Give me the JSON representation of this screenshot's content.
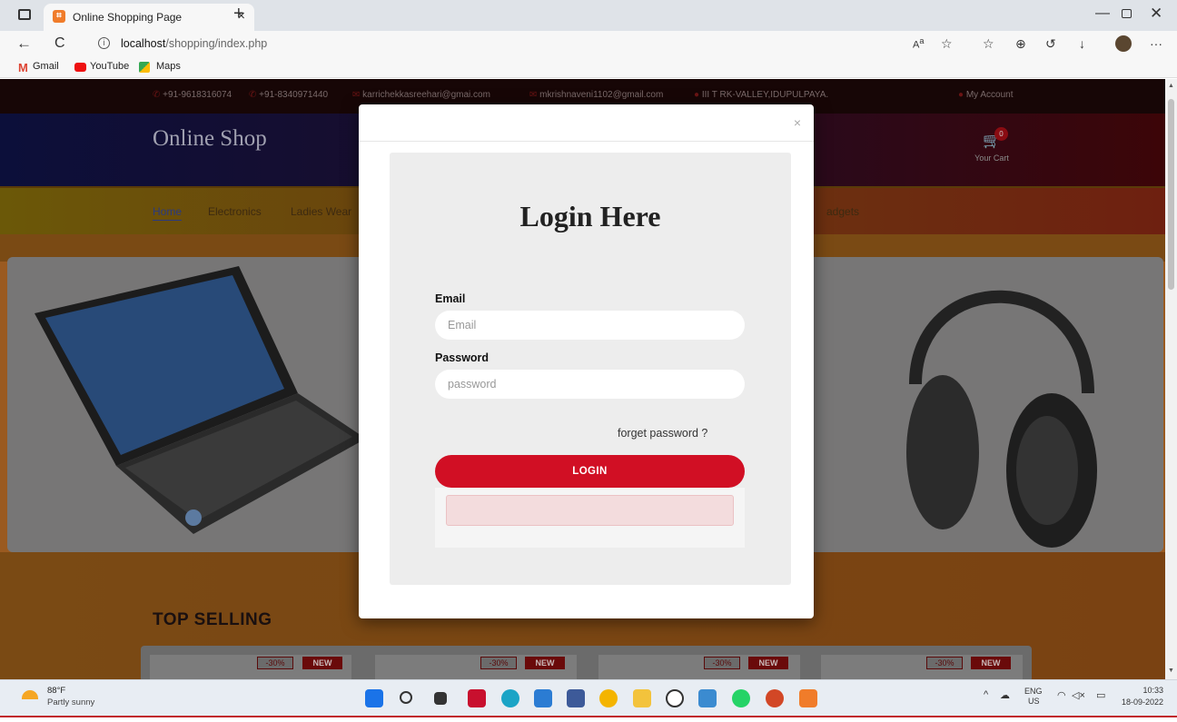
{
  "browser": {
    "tab_title": "Online Shopping Page",
    "tab_close": "×",
    "new_tab": "+",
    "url_host": "localhost",
    "url_path": "/shopping/index.php",
    "window_min": "—",
    "window_close": "✕",
    "bookmarks": [
      {
        "label": "Gmail"
      },
      {
        "label": "YouTube"
      },
      {
        "label": "Maps"
      }
    ],
    "nav_back": "←",
    "nav_refresh": "C",
    "info_icon": "i",
    "toolbar_more": "···"
  },
  "site": {
    "contact": {
      "phone1": "+91-9618316074",
      "phone2": "+91-8340971440",
      "email1": "karrichekkasreehari@gmai.com",
      "email2": "mkrishnaveni1102@gmail.com",
      "address": "III T RK-VALLEY,IDUPULPAYA."
    },
    "account_label": "My Account",
    "logo": "Online Shop",
    "cart_count": "0",
    "cart_label": "Your Cart",
    "nav": [
      "Home",
      "Electronics",
      "Ladies Wear",
      "adgets"
    ],
    "section_title": "TOP SELLING",
    "products": [
      {
        "discount": "-30%",
        "badge": "NEW"
      },
      {
        "discount": "-30%",
        "badge": "NEW"
      },
      {
        "discount": "-30%",
        "badge": "NEW"
      },
      {
        "discount": "-30%",
        "badge": "NEW"
      }
    ]
  },
  "login_modal": {
    "close": "×",
    "title": "Login Here",
    "email_label": "Email",
    "email_placeholder": "Email",
    "password_label": "Password",
    "password_placeholder": "password",
    "forget_link": "forget password ?",
    "login_button": "LOGIN"
  },
  "taskbar": {
    "temperature": "88°F",
    "weather": "Partly sunny",
    "lang": "ENG",
    "region": "US",
    "time": "10:33",
    "date": "18-09-2022"
  },
  "colors": {
    "login_button": "#d10f24",
    "alert_bg": "#f3dcdd"
  }
}
